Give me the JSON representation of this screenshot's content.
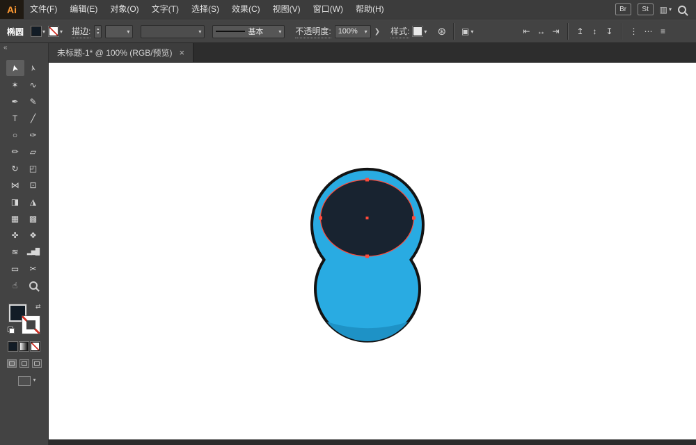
{
  "menubar": {
    "logo": "Ai",
    "items": [
      "文件(F)",
      "编辑(E)",
      "对象(O)",
      "文字(T)",
      "选择(S)",
      "效果(C)",
      "视图(V)",
      "窗口(W)",
      "帮助(H)"
    ],
    "bridge": "Br",
    "stock": "St",
    "workspace_glyph": "▥"
  },
  "controlbar": {
    "context_label": "椭圆",
    "stroke_label": "描边:",
    "stepper_up": "▲",
    "stepper_down": "▼",
    "brush_name": "基本",
    "opacity_label": "不透明度:",
    "opacity_value": "100%",
    "opacity_flyout": "❯",
    "style_label": "样式:",
    "recolor_glyph": "⊛",
    "align_to_glyph": "▣"
  },
  "align_icons": [
    {
      "name": "horizontal-align-left",
      "glyph": "⇤"
    },
    {
      "name": "horizontal-align-center",
      "glyph": "↔"
    },
    {
      "name": "horizontal-align-right",
      "glyph": "⇥"
    },
    {
      "name": "vertical-align-top",
      "glyph": "↥"
    },
    {
      "name": "vertical-align-center",
      "glyph": "↕"
    },
    {
      "name": "vertical-align-bottom",
      "glyph": "↧"
    },
    {
      "name": "distribute-vertical",
      "glyph": "⋮"
    },
    {
      "name": "distribute-horizontal",
      "glyph": "⋯"
    },
    {
      "name": "distribute-spacing",
      "glyph": "≡"
    }
  ],
  "tabbar": {
    "title": "未标题-1* @ 100% (RGB/预览)",
    "close": "×"
  },
  "toolbar": {
    "collapse": "«",
    "tools": [
      {
        "name": "selection",
        "glyph": "➤"
      },
      {
        "name": "direct-selection",
        "glyph": "➢"
      },
      {
        "name": "magic-wand",
        "glyph": "✶"
      },
      {
        "name": "lasso",
        "glyph": "∿"
      },
      {
        "name": "pen",
        "glyph": "✒"
      },
      {
        "name": "curvature",
        "glyph": "✎"
      },
      {
        "name": "type",
        "glyph": "T"
      },
      {
        "name": "line-segment",
        "glyph": "╱"
      },
      {
        "name": "ellipse",
        "glyph": "○"
      },
      {
        "name": "paintbrush",
        "glyph": "✑"
      },
      {
        "name": "pencil",
        "glyph": "✏"
      },
      {
        "name": "eraser",
        "glyph": "▱"
      },
      {
        "name": "rotate",
        "glyph": "↻"
      },
      {
        "name": "scale",
        "glyph": "◰"
      },
      {
        "name": "width",
        "glyph": "⋈"
      },
      {
        "name": "free-transform",
        "glyph": "⊡"
      },
      {
        "name": "shape-builder",
        "glyph": "◨"
      },
      {
        "name": "perspective-grid",
        "glyph": "◮"
      },
      {
        "name": "mesh",
        "glyph": "▦"
      },
      {
        "name": "gradient",
        "glyph": "▩"
      },
      {
        "name": "eyedropper",
        "glyph": "✜"
      },
      {
        "name": "blend",
        "glyph": "❖"
      },
      {
        "name": "symbol-sprayer",
        "glyph": "≋"
      },
      {
        "name": "column-graph",
        "glyph": "▂▅█"
      },
      {
        "name": "artboard",
        "glyph": "▭"
      },
      {
        "name": "slice",
        "glyph": "✂"
      },
      {
        "name": "hand",
        "glyph": "☝"
      },
      {
        "name": "zoom",
        "glyph": ""
      }
    ]
  },
  "canvas": {
    "shape": {
      "body_color": "#29abe2",
      "shade_color": "#1e92c6",
      "outline_color": "#131313",
      "ellipse_color": "#182330",
      "selection_color": "#ff4a3a"
    }
  }
}
